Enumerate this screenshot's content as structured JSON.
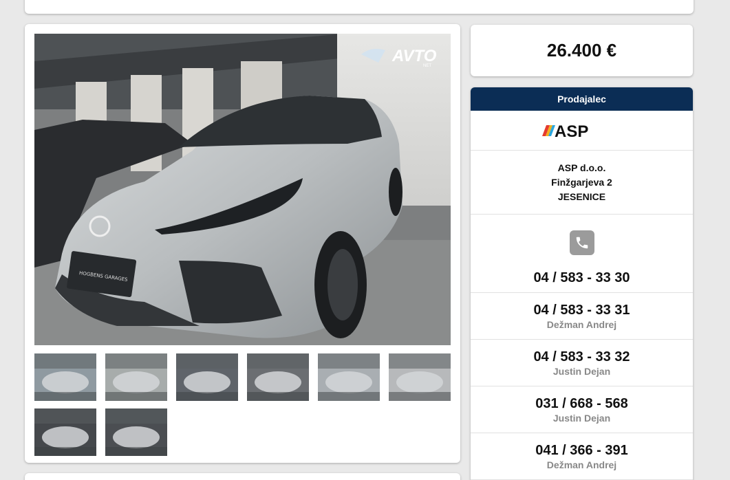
{
  "listing": {
    "photo_watermark": "AVTO",
    "photo_watermark_sub": "NET",
    "plate_text": "HOGBENS GARAGES",
    "thumbnails": [
      {
        "name": "thumb-1",
        "tone": "#8f9aa1"
      },
      {
        "name": "thumb-2",
        "tone": "#a7acab"
      },
      {
        "name": "thumb-3",
        "tone": "#5f646a"
      },
      {
        "name": "thumb-4",
        "tone": "#6b6e72"
      },
      {
        "name": "thumb-5",
        "tone": "#a9aeb2"
      },
      {
        "name": "thumb-6",
        "tone": "#b7b9bb"
      },
      {
        "name": "thumb-7",
        "tone": "#45484c"
      },
      {
        "name": "thumb-8",
        "tone": "#4b4e52"
      }
    ]
  },
  "price": "26.400 €",
  "seller": {
    "header": "Prodajalec",
    "logo_text": "ASP",
    "company": "ASP d.o.o.",
    "street": "Finžgarjeva 2",
    "city": "JESENICE",
    "phones": [
      {
        "number": "04 / 583 - 33 30",
        "name": ""
      },
      {
        "number": "04 / 583 - 33 31",
        "name": "Dežman Andrej"
      },
      {
        "number": "04 / 583 - 33 32",
        "name": "Justin Dejan"
      },
      {
        "number": "031 / 668 - 568",
        "name": "Justin Dejan"
      },
      {
        "number": "041 / 366 - 391",
        "name": "Dežman Andrej"
      }
    ],
    "colors": {
      "header_bg": "#0b2d55",
      "icon_bg": "#9b9b9b"
    }
  }
}
